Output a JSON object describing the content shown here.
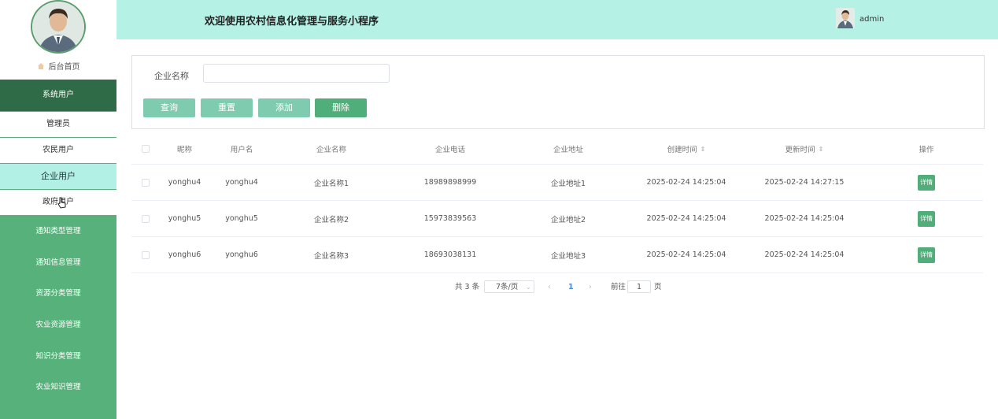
{
  "app": {
    "title": "欢迎使用农村信息化管理与服务小程序",
    "user": "admin"
  },
  "sidebar": {
    "home": "后台首页",
    "group_label": "系统用户",
    "sub_items": [
      "管理员",
      "农民用户",
      "企业用户",
      "政府用户"
    ],
    "active_item": "企业用户",
    "menu_items": [
      "通知类型管理",
      "通知信息管理",
      "资源分类管理",
      "农业资源管理",
      "知识分类管理",
      "农业知识管理"
    ]
  },
  "search": {
    "label": "企业名称",
    "value": "",
    "placeholder": "",
    "buttons": {
      "query": "查询",
      "reset": "重置",
      "add": "添加",
      "delete": "删除"
    }
  },
  "table": {
    "columns": [
      "昵称",
      "用户名",
      "企业名称",
      "企业电话",
      "企业地址",
      "创建时间",
      "更新时间",
      "操作"
    ],
    "rows": [
      [
        "yonghu4",
        "yonghu4",
        "企业名称1",
        "18989898999",
        "企业地址1",
        "2025-02-24 14:25:04",
        "2025-02-24 14:27:15",
        "详情"
      ],
      [
        "yonghu5",
        "yonghu5",
        "企业名称2",
        "15973839563",
        "企业地址2",
        "2025-02-24 14:25:04",
        "2025-02-24 14:25:04",
        "详情"
      ],
      [
        "yonghu6",
        "yonghu6",
        "企业名称3",
        "18693038131",
        "企业地址3",
        "2025-02-24 14:25:04",
        "2025-02-24 14:25:04",
        "详情"
      ]
    ]
  },
  "pagination": {
    "total": "共 3 条",
    "page_size": "7条/页",
    "current_page": "1",
    "goto_label": "前往",
    "goto_value": "1",
    "page_unit": "页"
  },
  "colors": {
    "header_bg": "#b5f1e5",
    "sidebar_active_group": "#2f6b46",
    "menu_green": "#56b27a",
    "button_green": "#4fae79"
  },
  "icons": [
    "home-icon",
    "avatar",
    "pointer-cursor-icon",
    "sort-icon",
    "chevron-down-icon",
    "chevron-left-icon",
    "chevron-right-icon"
  ]
}
